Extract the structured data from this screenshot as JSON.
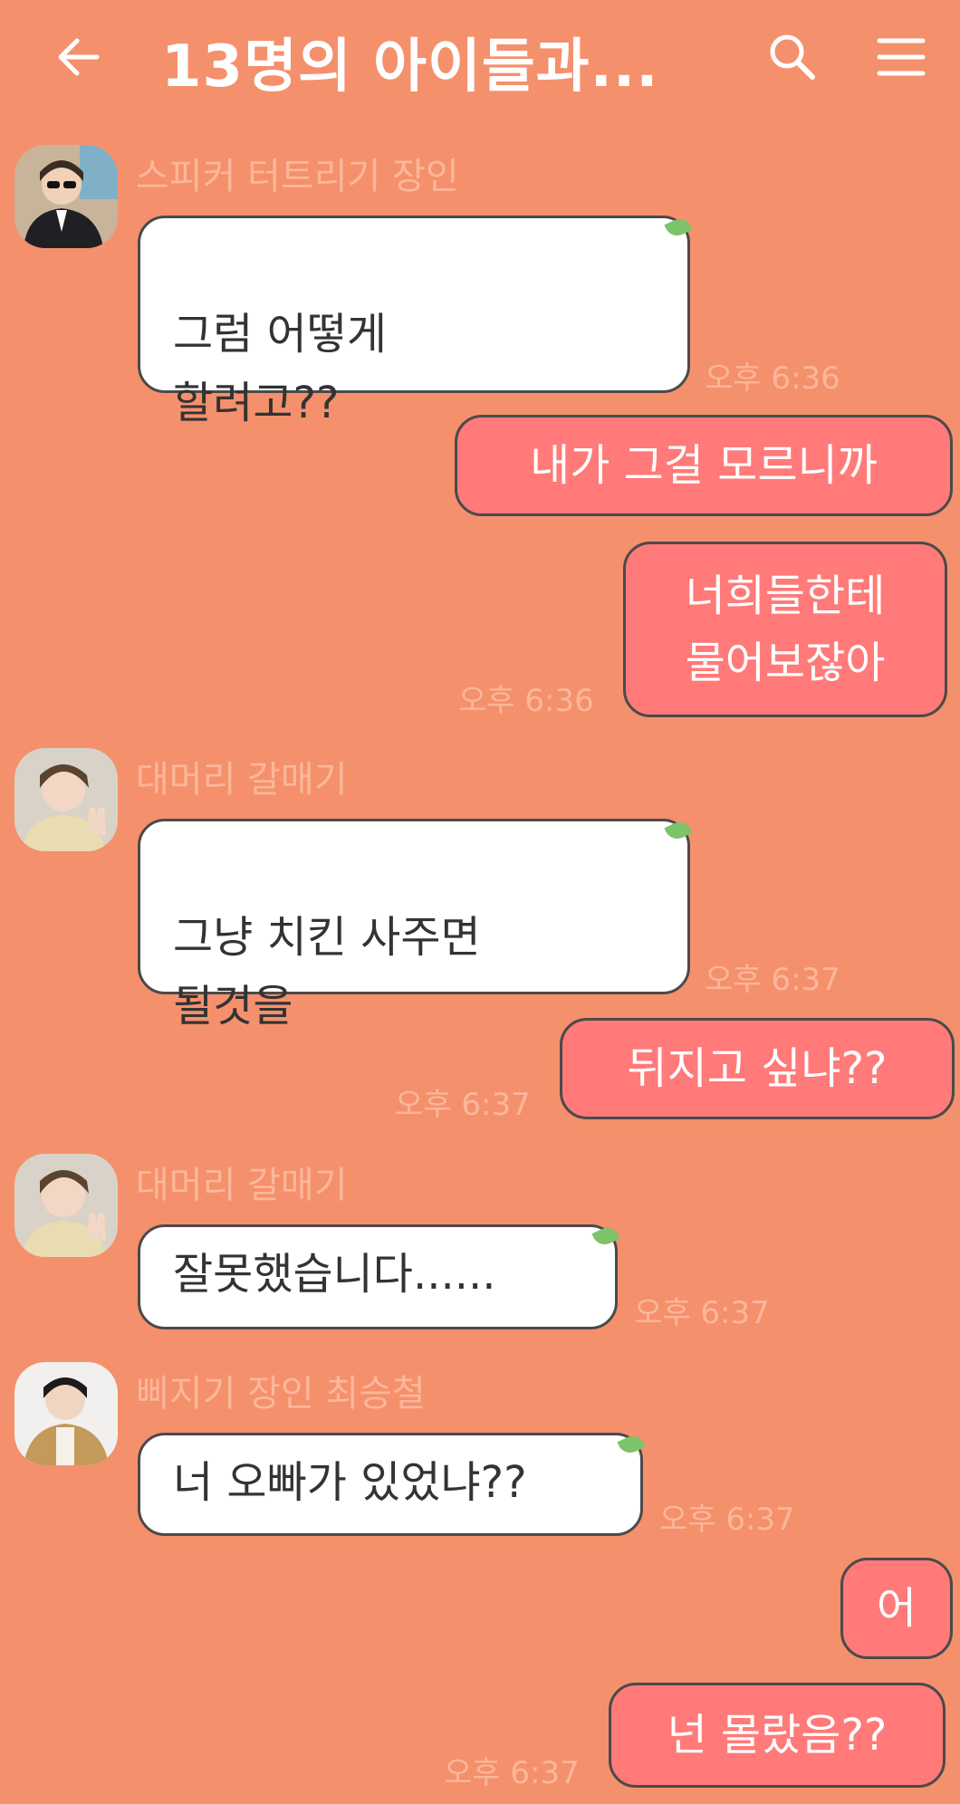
{
  "header": {
    "title": "13명의 아이들과...",
    "back_icon": "back-arrow-icon",
    "search_icon": "search-icon",
    "menu_icon": "hamburger-menu-icon",
    "text_color": "#ffffff"
  },
  "theme": {
    "background": "#f5906c",
    "incoming_bubble": "#ffffff",
    "outgoing_bubble": "#ff7a79",
    "name_color": "#fbb79a",
    "leaf_color": "#7cc36a"
  },
  "messages": [
    {
      "sender": "스피커 터트리기 장인",
      "text": "그럼 어떻게\n할려고??",
      "time": "오후 6:36"
    },
    {
      "text": "내가 그걸 모르니까"
    },
    {
      "text": "너희들한테\n물어보잖아",
      "time": "오후 6:36"
    },
    {
      "sender": "대머리 갈매기",
      "text": "그냥 치킨 사주면\n될것을",
      "time": "오후 6:37"
    },
    {
      "text": "뒤지고 싶냐??",
      "time": "오후 6:37"
    },
    {
      "sender": "대머리 갈매기",
      "text": "잘못했습니다......",
      "time": "오후 6:37"
    },
    {
      "sender": "삐지기 장인 최승철",
      "text": "너 오빠가 있었냐??",
      "time": "오후 6:37"
    },
    {
      "text": "어"
    },
    {
      "text": "넌 몰랐음??",
      "time": "오후 6:37"
    }
  ]
}
